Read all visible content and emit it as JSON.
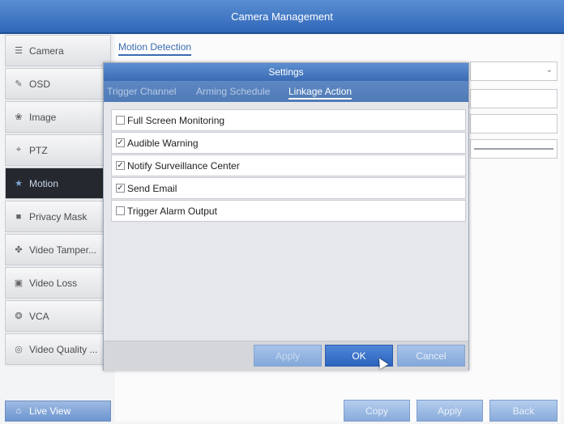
{
  "window": {
    "title": "Camera Management"
  },
  "sidebar": {
    "items": [
      {
        "label": "Camera",
        "icon": "camera-icon",
        "glyph": "☰"
      },
      {
        "label": "OSD",
        "icon": "osd-icon",
        "glyph": "✎"
      },
      {
        "label": "Image",
        "icon": "image-icon",
        "glyph": "❀"
      },
      {
        "label": "PTZ",
        "icon": "ptz-icon",
        "glyph": "⌖"
      },
      {
        "label": "Motion",
        "icon": "motion-icon",
        "glyph": "★"
      },
      {
        "label": "Privacy Mask",
        "icon": "privacy-mask-icon",
        "glyph": "■"
      },
      {
        "label": "Video Tamper...",
        "icon": "video-tamper-icon",
        "glyph": "✤"
      },
      {
        "label": "Video Loss",
        "icon": "video-loss-icon",
        "glyph": "▣"
      },
      {
        "label": "VCA",
        "icon": "vca-icon",
        "glyph": "❂"
      },
      {
        "label": "Video Quality ...",
        "icon": "video-quality-icon",
        "glyph": "◎"
      }
    ],
    "active_item": "Motion",
    "live_view": {
      "label": "Live View",
      "icon": "home-icon",
      "glyph": "⌂"
    }
  },
  "main": {
    "tab_label": "Motion Detection"
  },
  "bottom_buttons": {
    "copy": "Copy",
    "apply": "Apply",
    "back": "Back"
  },
  "dialog": {
    "title": "Settings",
    "tabs": [
      "Trigger Channel",
      "Arming Schedule",
      "Linkage Action"
    ],
    "active_tab": "Linkage Action",
    "options": [
      {
        "label": "Full Screen Monitoring",
        "checked": false
      },
      {
        "label": "Audible Warning",
        "checked": true
      },
      {
        "label": "Notify Surveillance Center",
        "checked": true
      },
      {
        "label": "Send Email",
        "checked": true
      },
      {
        "label": "Trigger Alarm Output",
        "checked": false
      }
    ],
    "buttons": {
      "apply": "Apply",
      "ok": "OK",
      "cancel": "Cancel"
    }
  }
}
